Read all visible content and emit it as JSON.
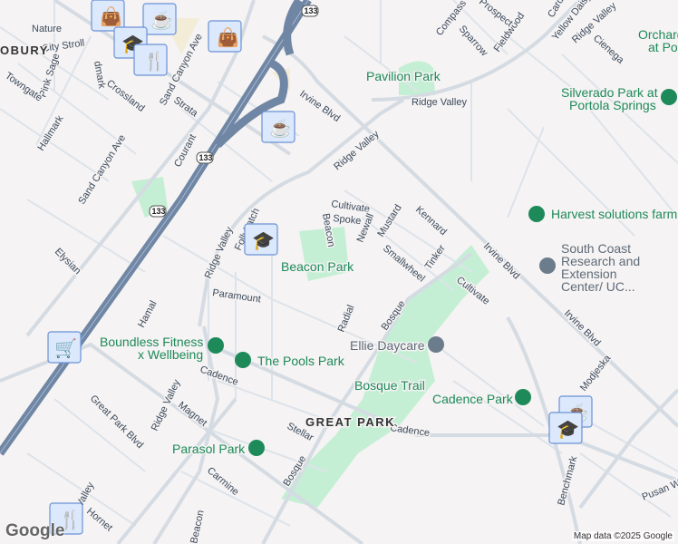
{
  "streets": [
    "Nature",
    "City Stroll",
    "Pink Sage",
    "Towngate",
    "Hallmark",
    "Crossland",
    "Sand Canyon Ave",
    "Sand Canyon Ave",
    "Strata",
    "Courant",
    "Elysian",
    "Ridge Valley",
    "Follyhatch",
    "Irvine Blvd",
    "Ridge Valley",
    "Ridge Valley",
    "Ridge Valley",
    "Compass",
    "Sparrow",
    "Fieldwood",
    "Prospect",
    "Yellow Daisy",
    "Cienega",
    "Cultivate",
    "Spoke",
    "Beacon",
    "Newall",
    "Mustard",
    "Kennard",
    "Smallwheel",
    "Tinker",
    "Irvine Blvd",
    "Irvine Blvd",
    "Paramount",
    "Hamal",
    "Radial",
    "Bosque",
    "Cultivate",
    "Cadence",
    "Magnet",
    "Ridge Valley",
    "Great Park Blvd",
    "Stellar",
    "Cadence",
    "Bosque",
    "Carmine",
    "Modjeska",
    "Benchmark",
    "Pusan Wy",
    "Beacon",
    "Hornet",
    "Valley",
    "dmark",
    "Cardinal"
  ],
  "parks": [
    "Pavilion Park",
    "Silverado Park at",
    "Portola Springs",
    "Harvest solutions farm",
    "Beacon Park",
    "Boundless Fitness",
    "x Wellbeing",
    "The Pools Park",
    "Bosque Trail",
    "Cadence Park",
    "Parasol Park",
    "Orchard",
    "at Portola"
  ],
  "places": [
    "South Coast",
    "Research and",
    "Extension",
    "Center/ UC...",
    "Ellie Daycare"
  ],
  "districts": [
    "GREAT PARK",
    "OBURY"
  ],
  "highway_shields": [
    "133",
    "133",
    "133"
  ],
  "markers": [
    "coffee-icon",
    "shopping-bag-icon",
    "graduation-cap-icon",
    "restaurant-icon",
    "shopping-bag-icon",
    "coffee-icon",
    "graduation-cap-icon",
    "shopping-cart-icon",
    "coffee-icon",
    "graduation-cap-icon",
    "restaurant-icon"
  ],
  "attribution": "Map data ©2025 Google",
  "logo": "Google",
  "colors": {
    "park": "#1e8a5a",
    "park_fill": "#c5efd4",
    "highway": "#6f86a5",
    "marker_fill": "#dce8fb",
    "marker_icon": "#0f3d63"
  }
}
